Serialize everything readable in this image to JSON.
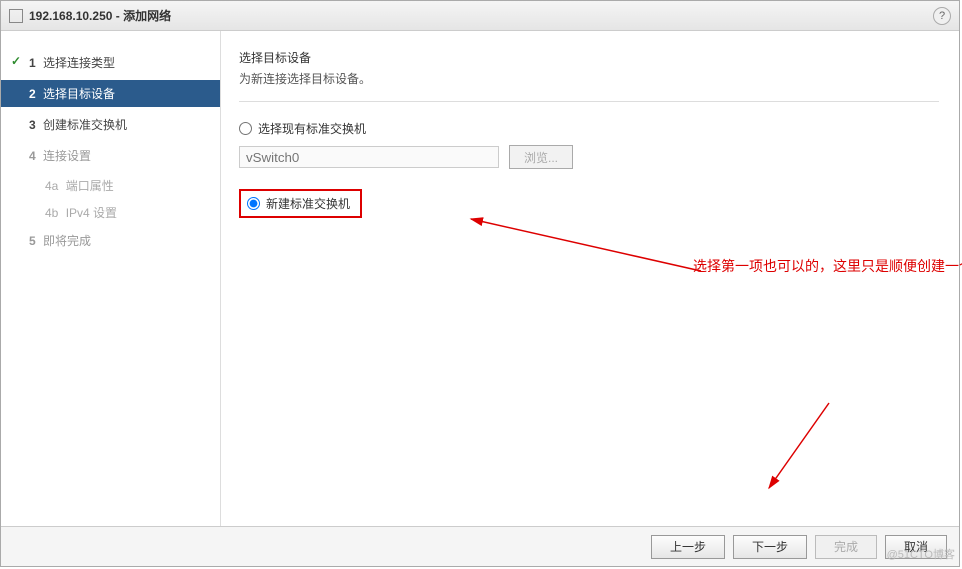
{
  "titleBar": {
    "host": "192.168.10.250",
    "sep": " - ",
    "title": "添加网络"
  },
  "help": {
    "symbol": "?"
  },
  "steps": {
    "s1": {
      "num": "1",
      "label": "选择连接类型"
    },
    "s2": {
      "num": "2",
      "label": "选择目标设备"
    },
    "s3": {
      "num": "3",
      "label": "创建标准交换机"
    },
    "s4": {
      "num": "4",
      "label": "连接设置"
    },
    "s4a": {
      "num": "4a",
      "label": "端口属性"
    },
    "s4b": {
      "num": "4b",
      "label": "IPv4 设置"
    },
    "s5": {
      "num": "5",
      "label": "即将完成"
    }
  },
  "content": {
    "heading": "选择目标设备",
    "subheading": "为新连接选择目标设备。",
    "radio1_label": "选择现有标准交换机",
    "vswitch_placeholder": "vSwitch0",
    "browse_label": "浏览...",
    "radio2_label": "新建标准交换机"
  },
  "annotation": {
    "text": "选择第一项也可以的，这里只是顺便创建一个新的虚拟交换机，"
  },
  "footer": {
    "back": "上一步",
    "next": "下一步",
    "finish": "完成",
    "cancel": "取消"
  },
  "watermark": "@51CTO博客"
}
